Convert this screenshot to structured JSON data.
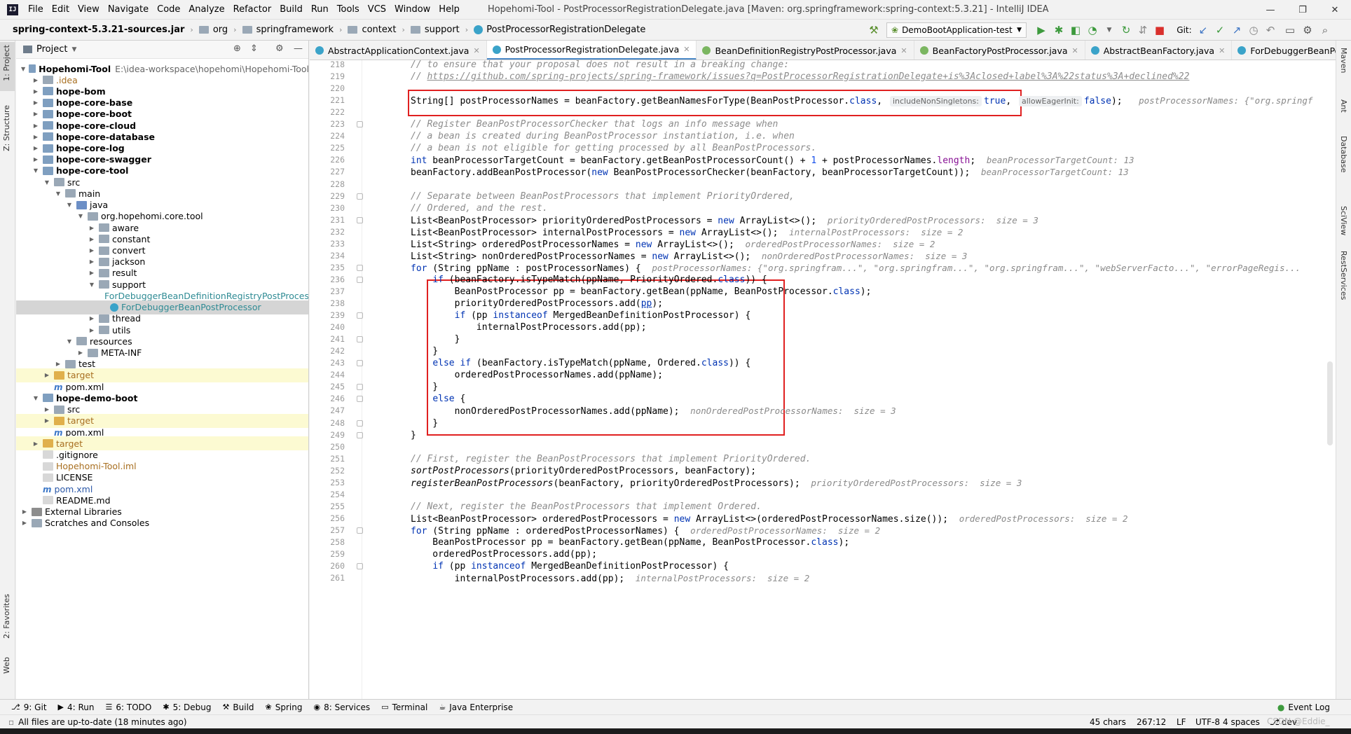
{
  "window": {
    "title": "Hopehomi-Tool - PostProcessorRegistrationDelegate.java [Maven: org.springframework:spring-context:5.3.21] - IntelliJ IDEA",
    "menu": [
      "File",
      "Edit",
      "View",
      "Navigate",
      "Code",
      "Analyze",
      "Refactor",
      "Build",
      "Run",
      "Tools",
      "VCS",
      "Window",
      "Help"
    ],
    "controls": {
      "minimize": "—",
      "maximize": "❐",
      "close": "✕"
    }
  },
  "breadcrumb": [
    "spring-context-5.3.21-sources.jar",
    "org",
    "springframework",
    "context",
    "support",
    "PostProcessorRegistrationDelegate"
  ],
  "toolbar": {
    "run_config": "DemoBootApplication-test",
    "git_label": "Git:"
  },
  "left_tool_tabs": [
    "1: Project",
    "Z: Structure",
    "2: Favorites",
    "Web"
  ],
  "right_tool_tabs": [
    "Maven",
    "Ant",
    "Database",
    "SciView",
    "RestServices"
  ],
  "project_panel": {
    "title": "Project",
    "tree": [
      {
        "label": "Hopehomi-Tool",
        "extra": "E:\\idea-workspace\\hopehomi\\Hopehomi-Tool",
        "indent": 0,
        "arrow": "▼",
        "icon": "f-mod",
        "style": "bold"
      },
      {
        "label": ".idea",
        "indent": 1,
        "arrow": "▶",
        "icon": "f-gray",
        "style": "c-orange"
      },
      {
        "label": "hope-bom",
        "indent": 1,
        "arrow": "▶",
        "icon": "f-mod",
        "style": "bold"
      },
      {
        "label": "hope-core-base",
        "indent": 1,
        "arrow": "▶",
        "icon": "f-mod",
        "style": "bold"
      },
      {
        "label": "hope-core-boot",
        "indent": 1,
        "arrow": "▶",
        "icon": "f-mod",
        "style": "bold"
      },
      {
        "label": "hope-core-cloud",
        "indent": 1,
        "arrow": "▶",
        "icon": "f-mod",
        "style": "bold"
      },
      {
        "label": "hope-core-database",
        "indent": 1,
        "arrow": "▶",
        "icon": "f-mod",
        "style": "bold"
      },
      {
        "label": "hope-core-log",
        "indent": 1,
        "arrow": "▶",
        "icon": "f-mod",
        "style": "bold"
      },
      {
        "label": "hope-core-swagger",
        "indent": 1,
        "arrow": "▶",
        "icon": "f-mod",
        "style": "bold"
      },
      {
        "label": "hope-core-tool",
        "indent": 1,
        "arrow": "▼",
        "icon": "f-mod",
        "style": "bold"
      },
      {
        "label": "src",
        "indent": 2,
        "arrow": "▼",
        "icon": "f-gray",
        "style": ""
      },
      {
        "label": "main",
        "indent": 3,
        "arrow": "▼",
        "icon": "f-gray",
        "style": ""
      },
      {
        "label": "java",
        "indent": 4,
        "arrow": "▼",
        "icon": "f-blue",
        "style": ""
      },
      {
        "label": "org.hopehomi.core.tool",
        "indent": 5,
        "arrow": "▼",
        "icon": "f-gray",
        "style": ""
      },
      {
        "label": "aware",
        "indent": 6,
        "arrow": "▶",
        "icon": "f-gray",
        "style": ""
      },
      {
        "label": "constant",
        "indent": 6,
        "arrow": "▶",
        "icon": "f-gray",
        "style": ""
      },
      {
        "label": "convert",
        "indent": 6,
        "arrow": "▶",
        "icon": "f-gray",
        "style": ""
      },
      {
        "label": "jackson",
        "indent": 6,
        "arrow": "▶",
        "icon": "f-gray",
        "style": ""
      },
      {
        "label": "result",
        "indent": 6,
        "arrow": "▶",
        "icon": "f-gray",
        "style": ""
      },
      {
        "label": "support",
        "indent": 6,
        "arrow": "▼",
        "icon": "f-gray",
        "style": ""
      },
      {
        "label": "ForDebuggerBeanDefinitionRegistryPostProcessor",
        "indent": 7,
        "arrow": "",
        "icon": "ic-c",
        "style": "c-teal"
      },
      {
        "label": "ForDebuggerBeanPostProcessor",
        "indent": 7,
        "arrow": "",
        "icon": "ic-c",
        "style": "c-teal sel"
      },
      {
        "label": "thread",
        "indent": 6,
        "arrow": "▶",
        "icon": "f-gray",
        "style": ""
      },
      {
        "label": "utils",
        "indent": 6,
        "arrow": "▶",
        "icon": "f-gray",
        "style": ""
      },
      {
        "label": "resources",
        "indent": 4,
        "arrow": "▼",
        "icon": "f-gray",
        "style": ""
      },
      {
        "label": "META-INF",
        "indent": 5,
        "arrow": "▶",
        "icon": "f-gray",
        "style": ""
      },
      {
        "label": "test",
        "indent": 3,
        "arrow": "▶",
        "icon": "f-gray",
        "style": ""
      },
      {
        "label": "target",
        "indent": 2,
        "arrow": "▶",
        "icon": "f-orange",
        "style": "c-orange hl-orange"
      },
      {
        "label": "pom.xml",
        "indent": 2,
        "arrow": "",
        "icon": "ic-m",
        "style": ""
      },
      {
        "label": "hope-demo-boot",
        "indent": 1,
        "arrow": "▼",
        "icon": "f-mod",
        "style": "bold"
      },
      {
        "label": "src",
        "indent": 2,
        "arrow": "▶",
        "icon": "f-gray",
        "style": ""
      },
      {
        "label": "target",
        "indent": 2,
        "arrow": "▶",
        "icon": "f-orange",
        "style": "c-orange hl-orange"
      },
      {
        "label": "pom.xml",
        "indent": 2,
        "arrow": "",
        "icon": "ic-m",
        "style": ""
      },
      {
        "label": "target",
        "indent": 1,
        "arrow": "▶",
        "icon": "f-orange",
        "style": "c-orange hl-orange"
      },
      {
        "label": ".gitignore",
        "indent": 1,
        "arrow": "",
        "icon": "ic-file",
        "style": ""
      },
      {
        "label": "Hopehomi-Tool.iml",
        "indent": 1,
        "arrow": "",
        "icon": "ic-file",
        "style": "c-orange"
      },
      {
        "label": "LICENSE",
        "indent": 1,
        "arrow": "",
        "icon": "ic-file",
        "style": ""
      },
      {
        "label": "pom.xml",
        "indent": 1,
        "arrow": "",
        "icon": "ic-m",
        "style": "c-blue"
      },
      {
        "label": "README.md",
        "indent": 1,
        "arrow": "",
        "icon": "ic-file",
        "style": ""
      },
      {
        "label": "External Libraries",
        "indent": 0,
        "arrow": "▶",
        "icon": "f-lib",
        "style": ""
      },
      {
        "label": "Scratches and Consoles",
        "indent": 0,
        "arrow": "▶",
        "icon": "f-gray",
        "style": ""
      }
    ]
  },
  "editor_tabs": [
    {
      "label": "AbstractApplicationContext.java",
      "icon_color": "#3aa3c9",
      "active": false
    },
    {
      "label": "PostProcessorRegistrationDelegate.java",
      "icon_color": "#3aa3c9",
      "active": true
    },
    {
      "label": "BeanDefinitionRegistryPostProcessor.java",
      "icon_color": "#7bb661",
      "active": false
    },
    {
      "label": "BeanFactoryPostProcessor.java",
      "icon_color": "#7bb661",
      "active": false
    },
    {
      "label": "AbstractBeanFactory.java",
      "icon_color": "#3aa3c9",
      "active": false
    },
    {
      "label": "ForDebuggerBeanPostProcessor",
      "icon_color": "#3aa3c9",
      "active": false
    }
  ],
  "code": {
    "lines": [
      {
        "n": 218,
        "html": "<span class='cm'>// to ensure that your proposal does not result in a breaking change:</span>"
      },
      {
        "n": 219,
        "html": "<span class='cm'>// </span><span class='lnk'>https://github.com/spring-projects/spring-framework/issues?q=PostProcessorRegistrationDelegate+is%3Aclosed+label%3A%22status%3A+declined%22</span>"
      },
      {
        "n": 220,
        "html": ""
      },
      {
        "n": 221,
        "html": "String[] postProcessorNames = beanFactory.getBeanNamesForType(BeanPostProcessor.<span class='k'>class</span>, <span class='ihint'>includeNonSingletons:</span><span class='k'>true</span>, <span class='ihint'>allowEagerInit:</span><span class='k'>false</span>);   <span class='hint'>postProcessorNames: {\"org.springf</span>"
      },
      {
        "n": 222,
        "html": ""
      },
      {
        "n": 223,
        "html": "<span class='cm'>// Register BeanPostProcessorChecker that logs an info message when</span>"
      },
      {
        "n": 224,
        "html": "<span class='cm'>// a bean is created during BeanPostProcessor instantiation, i.e. when</span>"
      },
      {
        "n": 225,
        "html": "<span class='cm'>// a bean is not eligible for getting processed by all BeanPostProcessors.</span>"
      },
      {
        "n": 226,
        "html": "<span class='k'>int</span> beanProcessorTargetCount = beanFactory.getBeanPostProcessorCount() + <span class='num'>1</span> + postProcessorNames.<span class='fld'>length</span>;  <span class='hint'>beanProcessorTargetCount: 13</span>"
      },
      {
        "n": 227,
        "html": "beanFactory.addBeanPostProcessor(<span class='k'>new</span> BeanPostProcessorChecker(beanFactory, beanProcessorTargetCount));  <span class='hint'>beanProcessorTargetCount: 13</span>"
      },
      {
        "n": 228,
        "html": ""
      },
      {
        "n": 229,
        "html": "<span class='cm'>// Separate between BeanPostProcessors that implement PriorityOrdered,</span>"
      },
      {
        "n": 230,
        "html": "<span class='cm'>// Ordered, and the rest.</span>"
      },
      {
        "n": 231,
        "html": "List&lt;BeanPostProcessor&gt; priorityOrderedPostProcessors = <span class='k'>new</span> ArrayList&lt;&gt;();  <span class='hint'>priorityOrderedPostProcessors:  size = 3</span>"
      },
      {
        "n": 232,
        "html": "List&lt;BeanPostProcessor&gt; internalPostProcessors = <span class='k'>new</span> ArrayList&lt;&gt;();  <span class='hint'>internalPostProcessors:  size = 2</span>"
      },
      {
        "n": 233,
        "html": "List&lt;String&gt; orderedPostProcessorNames = <span class='k'>new</span> ArrayList&lt;&gt;();  <span class='hint'>orderedPostProcessorNames:  size = 2</span>"
      },
      {
        "n": 234,
        "html": "List&lt;String&gt; nonOrderedPostProcessorNames = <span class='k'>new</span> ArrayList&lt;&gt;();  <span class='hint'>nonOrderedPostProcessorNames:  size = 3</span>"
      },
      {
        "n": 235,
        "html": "<span class='k'>for</span> (String ppName : postProcessorNames) {  <span class='hint'>postProcessorNames: {\"org.springfram...\", \"org.springfram...\", \"org.springfram...\", \"webServerFacto...\", \"errorPageRegis...</span>"
      },
      {
        "n": 236,
        "html": "    <span class='k'>if</span> (beanFactory.isTypeMatch(ppName, PriorityOrdered.<span class='k'>class</span>)) {"
      },
      {
        "n": 237,
        "html": "        BeanPostProcessor pp = beanFactory.getBean(ppName, BeanPostProcessor.<span class='k'>class</span>);"
      },
      {
        "n": 238,
        "html": "        priorityOrderedPostProcessors.add(<span class='und'>pp</span>);"
      },
      {
        "n": 239,
        "html": "        <span class='k'>if</span> (pp <span class='k'>instanceof</span> MergedBeanDefinitionPostProcessor) {"
      },
      {
        "n": 240,
        "html": "            internalPostProcessors.add(pp);"
      },
      {
        "n": 241,
        "html": "        }"
      },
      {
        "n": 242,
        "html": "    }"
      },
      {
        "n": 243,
        "html": "    <span class='k'>else if</span> (beanFactory.isTypeMatch(ppName, Ordered.<span class='k'>class</span>)) {"
      },
      {
        "n": 244,
        "html": "        orderedPostProcessorNames.add(ppName);"
      },
      {
        "n": 245,
        "html": "    }"
      },
      {
        "n": 246,
        "html": "    <span class='k'>else</span> {"
      },
      {
        "n": 247,
        "html": "        nonOrderedPostProcessorNames.add(ppName);  <span class='hint'>nonOrderedPostProcessorNames:  size = 3</span>"
      },
      {
        "n": 248,
        "html": "    }"
      },
      {
        "n": 249,
        "html": "}"
      },
      {
        "n": 250,
        "html": ""
      },
      {
        "n": 251,
        "html": "<span class='cm'>// First, register the BeanPostProcessors that implement PriorityOrdered.</span>"
      },
      {
        "n": 252,
        "html": "<span class='ital'>sortPostProcessors</span>(priorityOrderedPostProcessors, beanFactory);"
      },
      {
        "n": 253,
        "html": "<span class='ital'>registerBeanPostProcessors</span>(beanFactory, priorityOrderedPostProcessors);  <span class='hint'>priorityOrderedPostProcessors:  size = 3</span>"
      },
      {
        "n": 254,
        "html": ""
      },
      {
        "n": 255,
        "html": "<span class='cm'>// Next, register the BeanPostProcessors that implement Ordered.</span>"
      },
      {
        "n": 256,
        "html": "List&lt;BeanPostProcessor&gt; orderedPostProcessors = <span class='k'>new</span> ArrayList&lt;&gt;(orderedPostProcessorNames.size());  <span class='hint'>orderedPostProcessors:  size = 2</span>"
      },
      {
        "n": 257,
        "html": "<span class='k'>for</span> (String ppName : orderedPostProcessorNames) {  <span class='hint'>orderedPostProcessorNames:  size = 2</span>"
      },
      {
        "n": 258,
        "html": "    BeanPostProcessor pp = beanFactory.getBean(ppName, BeanPostProcessor.<span class='k'>class</span>);"
      },
      {
        "n": 259,
        "html": "    orderedPostProcessors.add(pp);"
      },
      {
        "n": 260,
        "html": "    <span class='k'>if</span> (pp <span class='k'>instanceof</span> MergedBeanDefinitionPostProcessor) {"
      },
      {
        "n": 261,
        "html": "        internalPostProcessors.add(pp);  <span class='hint'>internalPostProcessors:  size = 2</span>"
      }
    ]
  },
  "bottom_tools": [
    {
      "icon": "⎇",
      "label": "9: Git"
    },
    {
      "icon": "▶",
      "label": "4: Run"
    },
    {
      "icon": "☰",
      "label": "6: TODO"
    },
    {
      "icon": "✱",
      "label": "5: Debug"
    },
    {
      "icon": "⚒",
      "label": "Build"
    },
    {
      "icon": "❀",
      "label": "Spring"
    },
    {
      "icon": "◉",
      "label": "8: Services"
    },
    {
      "icon": "▭",
      "label": "Terminal"
    },
    {
      "icon": "☕",
      "label": "Java Enterprise"
    }
  ],
  "event_log": "Event Log",
  "status": {
    "message": "All files are up-to-date (18 minutes ago)",
    "chars": "45 chars",
    "position": "267:12",
    "line_sep": "LF",
    "encoding": "UTF-8",
    "indent": "4 spaces",
    "branch": "dev",
    "watermark": "CSDN @Eddie_"
  }
}
